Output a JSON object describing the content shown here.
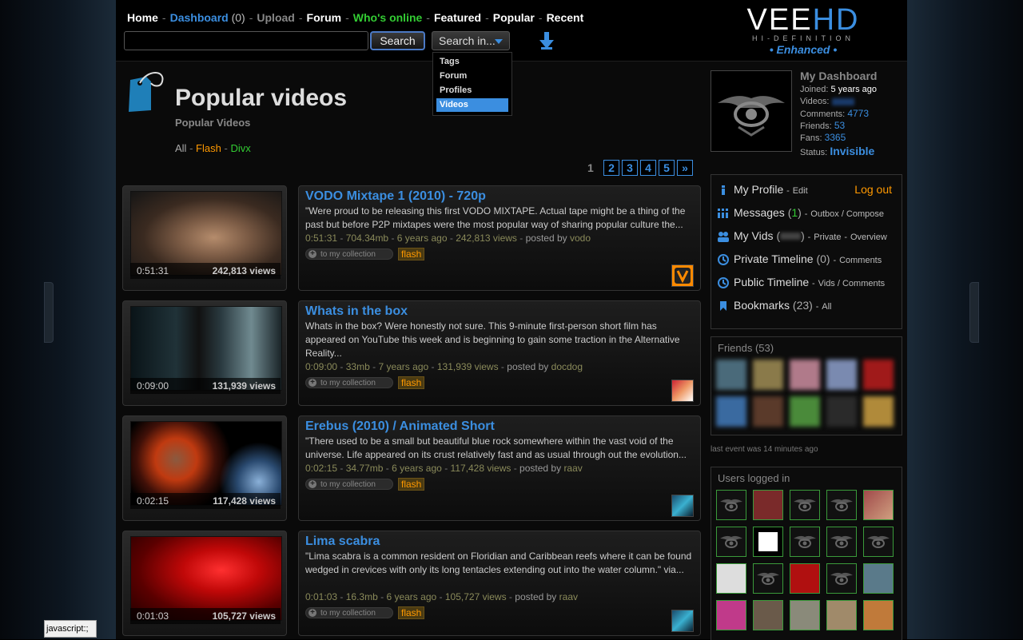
{
  "nav": {
    "home": "Home",
    "dashboard": "Dashboard",
    "dashboard_count": "(0)",
    "upload": "Upload",
    "forum": "Forum",
    "whos_online": "Who's online",
    "featured": "Featured",
    "popular": "Popular",
    "recent": "Recent",
    "sep": "-"
  },
  "search": {
    "value": "",
    "button": "Search",
    "scope_button": "Search in...",
    "options": [
      "Tags",
      "Forum",
      "Profiles",
      "Videos"
    ],
    "selected": "Videos"
  },
  "logo": {
    "main": "VEE",
    "main_accent": "HD",
    "sub": "HI-DEFINITION",
    "enhanced": "• Enhanced •"
  },
  "page": {
    "title": "Popular videos",
    "subtitle": "Popular Videos",
    "filters": {
      "all": "All",
      "flash": "Flash",
      "divx": "Divx",
      "sep": "-"
    }
  },
  "pager": {
    "current": "1",
    "pages": [
      "2",
      "3",
      "4",
      "5",
      "»"
    ]
  },
  "videos": [
    {
      "title": "VODO Mixtape 1 (2010) - 720p",
      "desc": "\"Were proud to be releasing this first VODO MIXTAPE. Actual tape might be a thing of the past but before P2P mixtapes were the most popular way of sharing popular culture the...",
      "duration": "0:51:31",
      "size": "704.34mb",
      "age": "6 years ago",
      "views": "242,813 views",
      "posted_by": "posted by",
      "user": "vodo",
      "collect": "to my collection",
      "format": "flash"
    },
    {
      "title": "Whats in the box",
      "desc": "Whats in the box? Were honestly not sure. This 9-minute first-person short film has appeared on YouTube this week and is beginning to gain some traction in the Alternative Reality...",
      "duration": "0:09:00",
      "size": "33mb",
      "age": "7 years ago",
      "views": "131,939 views",
      "posted_by": "posted by",
      "user": "docdog",
      "collect": "to my collection",
      "format": "flash"
    },
    {
      "title": "Erebus (2010) / Animated Short",
      "desc": "\"There used to be a small but beautiful blue rock somewhere within the vast void of the universe. Life appeared on its crust relatively fast and as usual through out the evolution...",
      "duration": "0:02:15",
      "size": "34.77mb",
      "age": "6 years ago",
      "views": "117,428 views",
      "posted_by": "posted by",
      "user": "raav",
      "collect": "to my collection",
      "format": "flash"
    },
    {
      "title": "Lima scabra",
      "desc": "\"Lima scabra is a common resident on Floridian and Caribbean reefs where it can be found wedged in crevices with only its long tentacles extending out into the water column.\" via...",
      "duration": "0:01:03",
      "size": "16.3mb",
      "age": "6 years ago",
      "views": "105,727 views",
      "posted_by": "posted by",
      "user": "raav",
      "collect": "to my collection",
      "format": "flash"
    }
  ],
  "dashboard": {
    "title": "My Dashboard",
    "joined_label": "Joined:",
    "joined": "5 years ago",
    "videos_label": "Videos:",
    "comments_label": "Comments:",
    "comments": "4773",
    "friends_label": "Friends:",
    "friends": "53",
    "fans_label": "Fans:",
    "fans": "3365",
    "status_label": "Status:",
    "status": "Invisible"
  },
  "menu": {
    "profile": "My Profile",
    "edit": "Edit",
    "logout": "Log out",
    "messages": "Messages",
    "messages_count": "1",
    "outbox": "Outbox / Compose",
    "vids": "My Vids",
    "private": "Private",
    "overview": "Overview",
    "private_timeline": "Private Timeline",
    "private_timeline_count": "(0)",
    "comments": "Comments",
    "public_timeline": "Public Timeline",
    "vids_comments": "Vids / Comments",
    "bookmarks": "Bookmarks",
    "bookmarks_count": "(23)",
    "all": "All",
    "sep": "-"
  },
  "friends_box": {
    "title": "Friends (53)"
  },
  "last_event": "last event was 14 minutes ago",
  "users_box": {
    "title": "Users logged in"
  },
  "colors": {
    "accent": "#3b8ee0",
    "flash": "#ff9900",
    "online": "#33cc33"
  }
}
